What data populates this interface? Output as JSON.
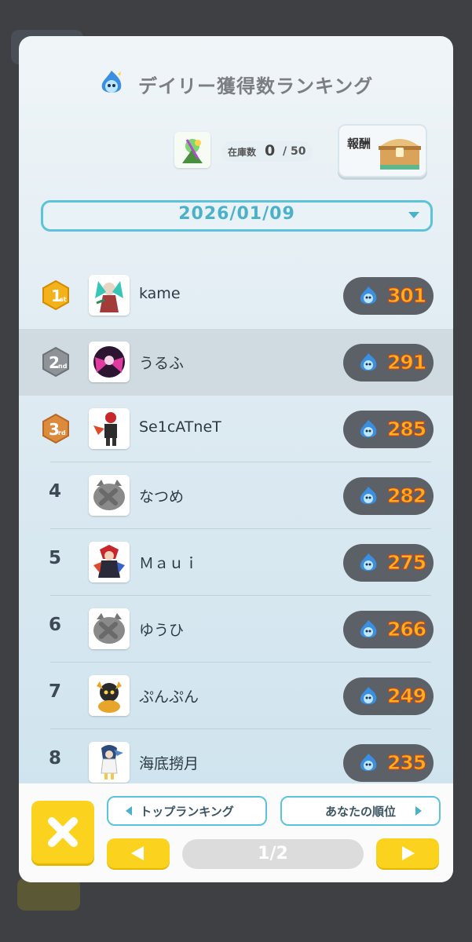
{
  "header": {
    "title": "デイリー獲得数ランキング"
  },
  "stock": {
    "label": "在庫数",
    "count": "0",
    "total": "/ 50"
  },
  "reward": {
    "label": "報酬"
  },
  "date_select": {
    "value": "2026/01/09"
  },
  "ranking": [
    {
      "rank": "1",
      "name": "kame",
      "score": "301",
      "medal": "1st"
    },
    {
      "rank": "2",
      "name": "うるふ",
      "score": "291",
      "medal": "2nd"
    },
    {
      "rank": "3",
      "name": "Se1cATneT",
      "score": "285",
      "medal": "3rd"
    },
    {
      "rank": "4",
      "name": "なつめ",
      "score": "282"
    },
    {
      "rank": "5",
      "name": "Ｍａｕｉ",
      "score": "275"
    },
    {
      "rank": "6",
      "name": "ゆうひ",
      "score": "266"
    },
    {
      "rank": "7",
      "name": "ぷんぷん",
      "score": "249"
    },
    {
      "rank": "8",
      "name": "海底撈月",
      "score": "235"
    }
  ],
  "bottom": {
    "top_ranking": "トップランキング",
    "your_rank": "あなたの順位",
    "page": "1/2"
  },
  "colors": {
    "accent": "#5cc3da",
    "yellow": "#fbd31f",
    "score_text": "#ffb21e",
    "gold": "#f3b21c",
    "silver": "#8e9398",
    "bronze": "#dc8a3c"
  }
}
